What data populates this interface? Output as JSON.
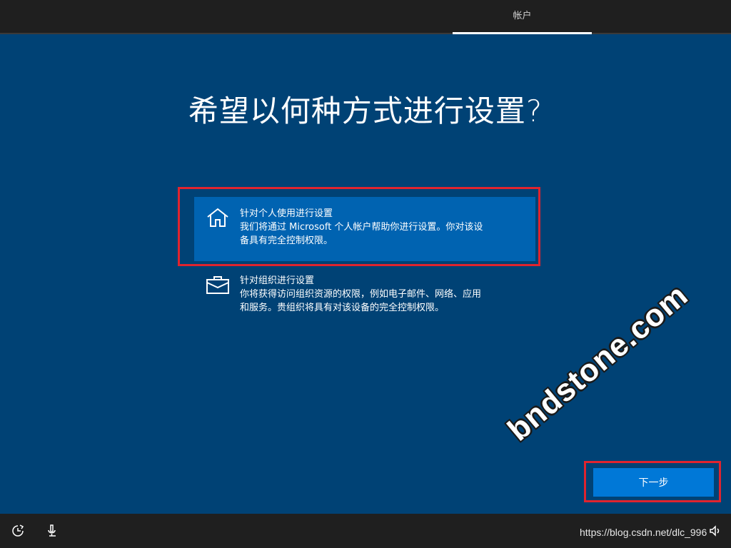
{
  "topbar": {
    "tab_label": "帐户"
  },
  "main": {
    "title": "希望以何种方式进行设置?"
  },
  "options": [
    {
      "icon": "home-icon",
      "title": "针对个人使用进行设置",
      "desc_line1": "我们将通过 Microsoft 个人帐户帮助你进行设置。你对该设",
      "desc_line2": "备具有完全控制权限。",
      "selected": true
    },
    {
      "icon": "briefcase-icon",
      "title": "针对组织进行设置",
      "desc_line1": "你将获得访问组织资源的权限，例如电子邮件、网络、应用",
      "desc_line2": "和服务。贵组织将具有对该设备的完全控制权限。",
      "selected": false
    }
  ],
  "next_button": {
    "label": "下一步"
  },
  "watermark": {
    "text": "bndstone.com"
  },
  "bottombar": {
    "url_text": "https://blog.csdn.net/dlc_996",
    "icons": [
      "ease-of-access-icon",
      "microphone-icon",
      "volume-icon"
    ]
  },
  "colors": {
    "background": "#004275",
    "selected_option": "#0063b1",
    "button": "#0078d7",
    "highlight": "#e0242e",
    "bar": "#1f1f1f"
  }
}
